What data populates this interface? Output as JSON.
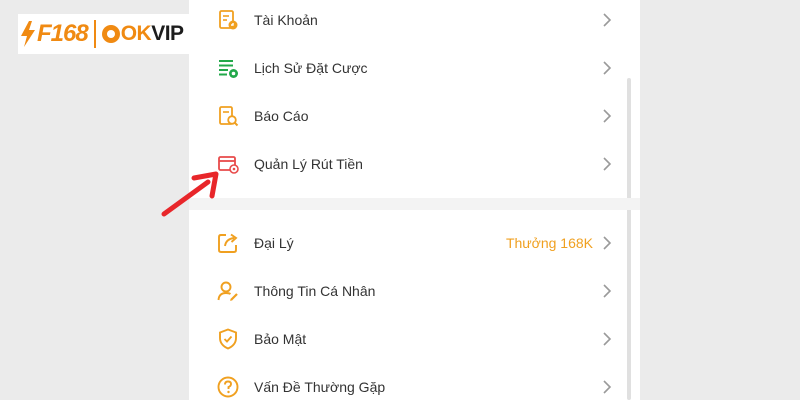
{
  "logo": {
    "f168_text": "F168",
    "okvip_ok": "OK",
    "okvip_vip": "VIP"
  },
  "menu": {
    "group1": [
      {
        "label": "Tài Khoản",
        "icon": "account-icon"
      },
      {
        "label": "Lịch Sử Đặt Cược",
        "icon": "bet-history-icon"
      },
      {
        "label": "Báo Cáo",
        "icon": "report-icon"
      },
      {
        "label": "Quản Lý Rút Tiền",
        "icon": "withdraw-management-icon"
      }
    ],
    "group2": [
      {
        "label": "Đại Lý",
        "icon": "agent-icon",
        "badge": "Thưởng 168K"
      },
      {
        "label": "Thông Tin Cá Nhân",
        "icon": "personal-info-icon"
      },
      {
        "label": "Bảo Mật",
        "icon": "security-icon"
      },
      {
        "label": "Vấn Đề Thường Gặp",
        "icon": "faq-icon"
      }
    ]
  },
  "colors": {
    "accent": "#f0a020",
    "green_icon": "#22a84a",
    "red_icon": "#e84a4a",
    "arrow": "#e8262a",
    "background": "#ebebeb"
  }
}
